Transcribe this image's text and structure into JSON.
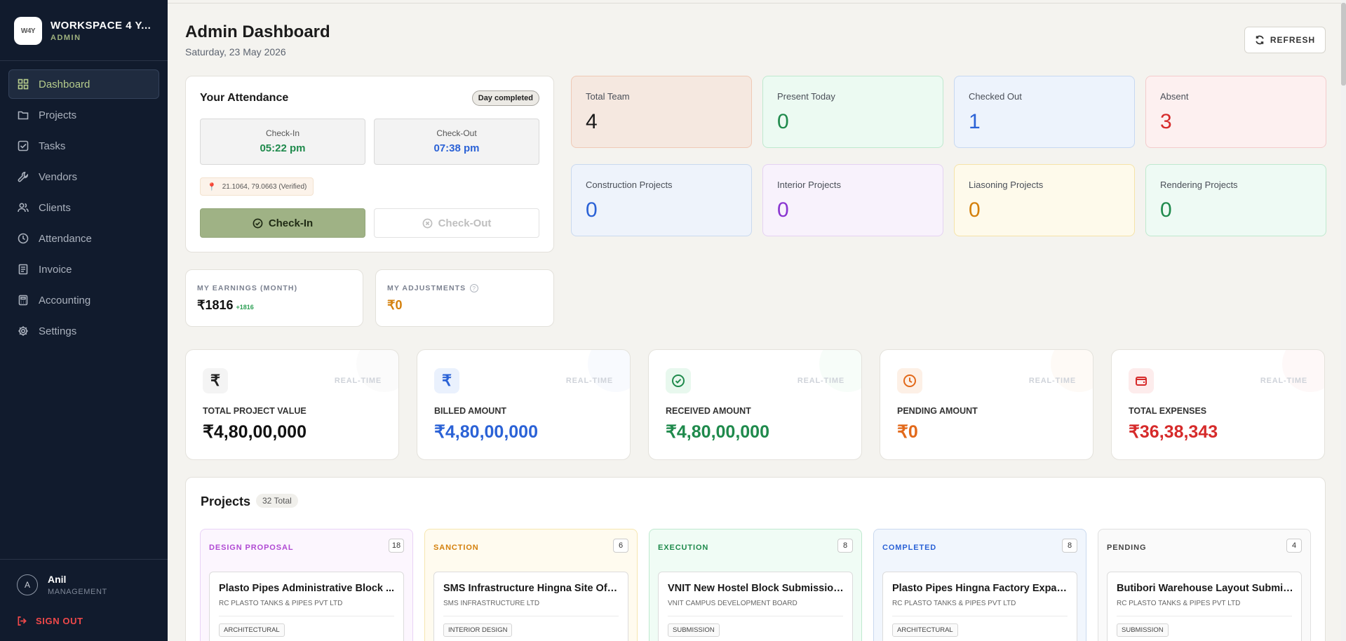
{
  "sidebar": {
    "brand_logo": "W4Y",
    "brand_name": "WORKSPACE 4 Y...",
    "brand_role": "ADMIN",
    "items": [
      {
        "label": "Dashboard",
        "icon": "grid-icon"
      },
      {
        "label": "Projects",
        "icon": "folder-icon"
      },
      {
        "label": "Tasks",
        "icon": "checkbox-icon"
      },
      {
        "label": "Vendors",
        "icon": "wrench-icon"
      },
      {
        "label": "Clients",
        "icon": "users-icon"
      },
      {
        "label": "Attendance",
        "icon": "clock-icon"
      },
      {
        "label": "Invoice",
        "icon": "receipt-icon"
      },
      {
        "label": "Accounting",
        "icon": "calculator-icon"
      },
      {
        "label": "Settings",
        "icon": "gear-icon"
      }
    ],
    "active_index": 0,
    "user": {
      "initial": "A",
      "name": "Anil",
      "role": "MANAGEMENT"
    },
    "signout_label": "SIGN OUT"
  },
  "header": {
    "title": "Admin Dashboard",
    "date": "Saturday, 23 May 2026",
    "refresh_label": "REFRESH"
  },
  "attendance": {
    "title": "Your Attendance",
    "badge": "Day completed",
    "checkin_label": "Check-In",
    "checkin_time": "05:22 pm",
    "checkout_label": "Check-Out",
    "checkout_time": "07:38 pm",
    "location": "21.1064, 79.0663 (Verified)",
    "btn_checkin": "Check-In",
    "btn_checkout": "Check-Out"
  },
  "earnings": {
    "label": "MY EARNINGS (MONTH)",
    "value": "₹1816",
    "delta": "+1816",
    "adj_label": "MY ADJUSTMENTS",
    "adj_value": "₹0"
  },
  "stats": [
    {
      "label": "Total Team",
      "value": "4",
      "bg": "#f5e8e0",
      "border": "#efc9b6",
      "color": "#1a1a1a"
    },
    {
      "label": "Present Today",
      "value": "0",
      "bg": "#ecfaf2",
      "border": "#bfe9cf",
      "color": "#1f8a4c"
    },
    {
      "label": "Checked Out",
      "value": "1",
      "bg": "#edf3fc",
      "border": "#c7d8f1",
      "color": "#2b62d6"
    },
    {
      "label": "Absent",
      "value": "3",
      "bg": "#fdf0f0",
      "border": "#f3cccc",
      "color": "#d62a2a"
    },
    {
      "label": "Construction Projects",
      "value": "0",
      "bg": "#eef3fb",
      "border": "#c9d9ef",
      "color": "#2b62d6"
    },
    {
      "label": "Interior Projects",
      "value": "0",
      "bg": "#f8f2fc",
      "border": "#e5d2f3",
      "color": "#8a35d0"
    },
    {
      "label": "Liasoning Projects",
      "value": "0",
      "bg": "#fefaeb",
      "border": "#f5e3a8",
      "color": "#d4800c"
    },
    {
      "label": "Rendering Projects",
      "value": "0",
      "bg": "#eefaf4",
      "border": "#bfe9cf",
      "color": "#1f8a4c"
    }
  ],
  "finance": [
    {
      "label": "TOTAL PROJECT VALUE",
      "value": "₹4,80,00,000",
      "rt": "REAL-TIME",
      "icon": "rupee-icon",
      "glyph": "₹",
      "color": "#111111",
      "icon_bg": "#f4f4f4",
      "icon_color": "#222222"
    },
    {
      "label": "BILLED AMOUNT",
      "value": "₹4,80,00,000",
      "rt": "REAL-TIME",
      "icon": "rupee-icon",
      "glyph": "₹",
      "color": "#2b62d6",
      "icon_bg": "#eaf1fd",
      "icon_color": "#2b62d6"
    },
    {
      "label": "RECEIVED AMOUNT",
      "value": "₹4,80,00,000",
      "rt": "REAL-TIME",
      "icon": "check-circle-icon",
      "glyph": "",
      "color": "#1f8a4c",
      "icon_bg": "#e8f8ee",
      "icon_color": "#1f8a4c"
    },
    {
      "label": "PENDING AMOUNT",
      "value": "₹0",
      "rt": "REAL-TIME",
      "icon": "clock-icon",
      "glyph": "",
      "color": "#e2691a",
      "icon_bg": "#fdf0e6",
      "icon_color": "#e2691a"
    },
    {
      "label": "TOTAL EXPENSES",
      "value": "₹36,38,343",
      "rt": "REAL-TIME",
      "icon": "wallet-icon",
      "glyph": "",
      "color": "#d62a2a",
      "icon_bg": "#fdecec",
      "icon_color": "#d62a2a"
    }
  ],
  "projects": {
    "title": "Projects",
    "total": "32 Total",
    "columns": [
      {
        "head": "DESIGN PROPOSAL",
        "count": "18",
        "color": "#b04ad3",
        "bg": "#fcf6fe",
        "border": "#e9d2f6",
        "card": {
          "title": "Plasto Pipes Administrative Block ...",
          "client": "RC PLASTO TANKS & PIPES PVT LTD",
          "tag": "ARCHITECTURAL"
        }
      },
      {
        "head": "SANCTION",
        "count": "6",
        "color": "#d4800c",
        "bg": "#fffbef",
        "border": "#f6e6b0",
        "card": {
          "title": "SMS Infrastructure Hingna Site Offi...",
          "client": "SMS INFRASTRUCTURE LTD",
          "tag": "INTERIOR DESIGN"
        }
      },
      {
        "head": "EXECUTION",
        "count": "8",
        "color": "#1f8a4c",
        "bg": "#f0fcf5",
        "border": "#bfe9cf",
        "card": {
          "title": "VNIT New Hostel Block Submission...",
          "client": "VNIT CAMPUS DEVELOPMENT BOARD",
          "tag": "SUBMISSION"
        }
      },
      {
        "head": "COMPLETED",
        "count": "8",
        "color": "#2b62d6",
        "bg": "#f1f6fd",
        "border": "#c9d9ef",
        "card": {
          "title": "Plasto Pipes Hingna Factory Expan...",
          "client": "RC PLASTO TANKS & PIPES PVT LTD",
          "tag": "ARCHITECTURAL"
        }
      },
      {
        "head": "PENDING",
        "count": "4",
        "color": "#444444",
        "bg": "#fafafa",
        "border": "#e0e0e0",
        "card": {
          "title": "Butibori Warehouse Layout Submis...",
          "client": "RC PLASTO TANKS & PIPES PVT LTD",
          "tag": "SUBMISSION"
        }
      }
    ]
  }
}
